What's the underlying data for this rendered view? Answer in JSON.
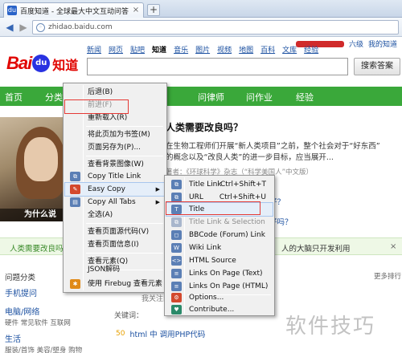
{
  "browser": {
    "tab_title": "百度知道 - 全球最大中文互动问答平台",
    "tab_close": "×",
    "new_tab": "+",
    "url": "zhidao.baidu.com"
  },
  "header": {
    "top_links": [
      "六级",
      "我的知道"
    ],
    "logo_bai": "Bai",
    "logo_du": "du",
    "logo_zhidao": "知道",
    "channels": [
      "新闻",
      "网页",
      "贴吧",
      "知道",
      "音乐",
      "图片",
      "视频",
      "地图",
      "百科",
      "文库",
      "经验"
    ],
    "search_button": "搜索答案"
  },
  "greenbar": {
    "items": [
      "首页",
      "分类",
      "问律师",
      "问作业",
      "经验"
    ]
  },
  "article": {
    "title": "人类需要改良吗？",
    "line1": "在生物工程师们开展“新人类项目”之前，整个社会对于“好东西”",
    "line2": "的概念以及“改良人类”的进一步目标，应当展开...",
    "source": "著者：《环球科学》杂志（“科学美国人”中文版）",
    "small1": "好？",
    "small2": "好吗？",
    "photo_caption": "为什么说"
  },
  "strip": {
    "left": "人类需要改良吗",
    "right": "人的大脑只开发利用",
    "close": "×"
  },
  "sidebar": {
    "heading": "问题分类",
    "more": "更多排行",
    "item1": "手机提问",
    "item2": "电脑/网络",
    "item2_sub": "硬件  常见软件  互联网",
    "item3": "生活",
    "item3_sub": "服装/首饰  美容/塑身  购物"
  },
  "content": {
    "liker": "我关注的",
    "keywords": "关键词：",
    "coin": "50",
    "answer": "html 中 调用PHP代码"
  },
  "watermark": "软件技巧",
  "context_menu": {
    "items": [
      {
        "label": "后退(B)",
        "disabled": false
      },
      {
        "label": "前进(F)",
        "disabled": true
      },
      {
        "label": "重新载入(R)",
        "disabled": false
      },
      {
        "label": "将此页加为书签(M)",
        "disabled": false
      },
      {
        "label": "页面另存为(P)...",
        "disabled": false
      },
      {
        "label": "查看背景图像(W)",
        "disabled": false
      },
      {
        "label": "Copy Title Link",
        "disabled": false
      },
      {
        "label": "Easy Copy",
        "disabled": false
      },
      {
        "label": "Copy All Tabs",
        "disabled": false
      },
      {
        "label": "全选(A)",
        "disabled": false
      },
      {
        "label": "查看页面源代码(V)",
        "disabled": false
      },
      {
        "label": "查看页面信息(I)",
        "disabled": false
      },
      {
        "label": "查看元素(Q)",
        "disabled": false
      },
      {
        "label": "JSON解码",
        "disabled": false
      },
      {
        "label": "使用 Firebug 查看元素",
        "disabled": false
      }
    ]
  },
  "submenu": {
    "items": [
      {
        "label": "Title Link",
        "shortcut": "Ctrl+Shift+T",
        "disabled": false
      },
      {
        "label": "URL",
        "shortcut": "Ctrl+Shift+U",
        "disabled": false
      },
      {
        "label": "Title",
        "shortcut": "",
        "disabled": false
      },
      {
        "label": "Title Link & Selection",
        "shortcut": "",
        "disabled": true
      },
      {
        "label": "BBCode (Forum) Link",
        "shortcut": "",
        "disabled": false
      },
      {
        "label": "Wiki Link",
        "shortcut": "",
        "disabled": false
      },
      {
        "label": "HTML Source",
        "shortcut": "",
        "disabled": false
      },
      {
        "label": "Links On Page (Text)",
        "shortcut": "",
        "disabled": false
      },
      {
        "label": "Links On Page (HTML)",
        "shortcut": "",
        "disabled": false
      },
      {
        "label": "Options...",
        "shortcut": "",
        "disabled": false
      },
      {
        "label": "Contribute...",
        "shortcut": "",
        "disabled": false
      }
    ]
  }
}
